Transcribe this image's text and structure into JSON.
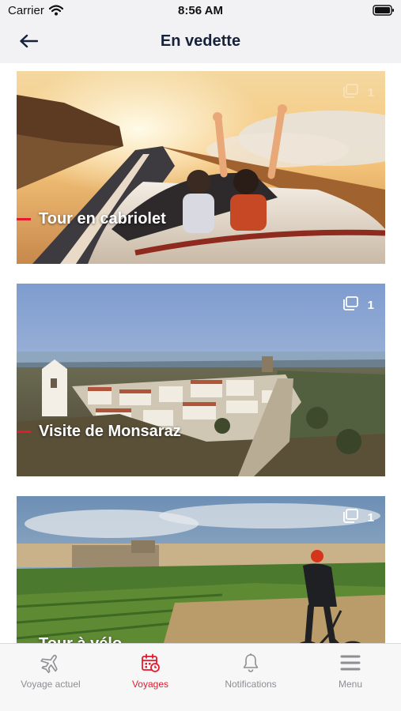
{
  "status_bar": {
    "carrier": "Carrier",
    "time": "8:56 AM"
  },
  "header": {
    "title": "En vedette",
    "back_icon": "arrow-left-icon"
  },
  "cards": [
    {
      "title": "Tour en cabriolet",
      "count": "1"
    },
    {
      "title": "Visite de Monsaraz",
      "count": "1"
    },
    {
      "title": "Tour à vélo",
      "count": "1"
    }
  ],
  "tab_bar": {
    "items": [
      {
        "label": "Voyage actuel",
        "icon": "airplane-icon"
      },
      {
        "label": "Voyages",
        "icon": "calendar-icon",
        "active": true
      },
      {
        "label": "Notifications",
        "icon": "bell-icon"
      },
      {
        "label": "Menu",
        "icon": "hamburger-icon"
      }
    ]
  },
  "colors": {
    "accent": "#e8192c",
    "header_bg": "#f2f2f4",
    "title": "#16223a",
    "inactive": "#8e8e93"
  }
}
